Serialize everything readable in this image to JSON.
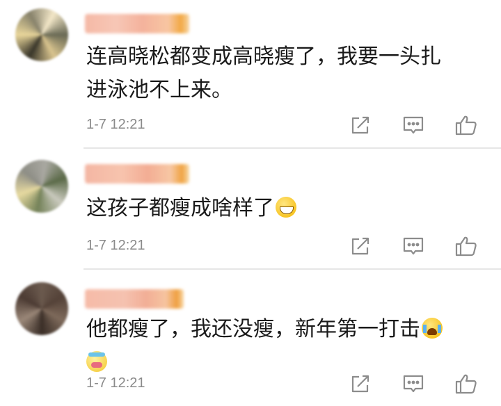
{
  "comments": [
    {
      "text": "连高晓松都变成高晓瘦了，我要一头扎进泳池不上来。",
      "line1": "连高晓松都变成高晓瘦了，我要一头扎",
      "line2": "进泳池不上来。",
      "time": "1-7 12:21",
      "emojis": []
    },
    {
      "text": "这孩子都瘦成啥样了",
      "time": "1-7 12:21",
      "emojis": [
        "grin-emoji"
      ]
    },
    {
      "text": "他都瘦了，我还没瘦，新年第一打击",
      "time": "1-7 12:21",
      "emojis": [
        "crying-emoji",
        "sick-emoji"
      ]
    }
  ],
  "icons": {
    "share": "share-icon",
    "comment": "comment-icon",
    "like": "thumbs-up-icon"
  },
  "colors": {
    "text": "#1a1a1a",
    "meta": "#8a8a8a",
    "icon": "#8c8c8c",
    "divider": "#e6e6e6"
  }
}
